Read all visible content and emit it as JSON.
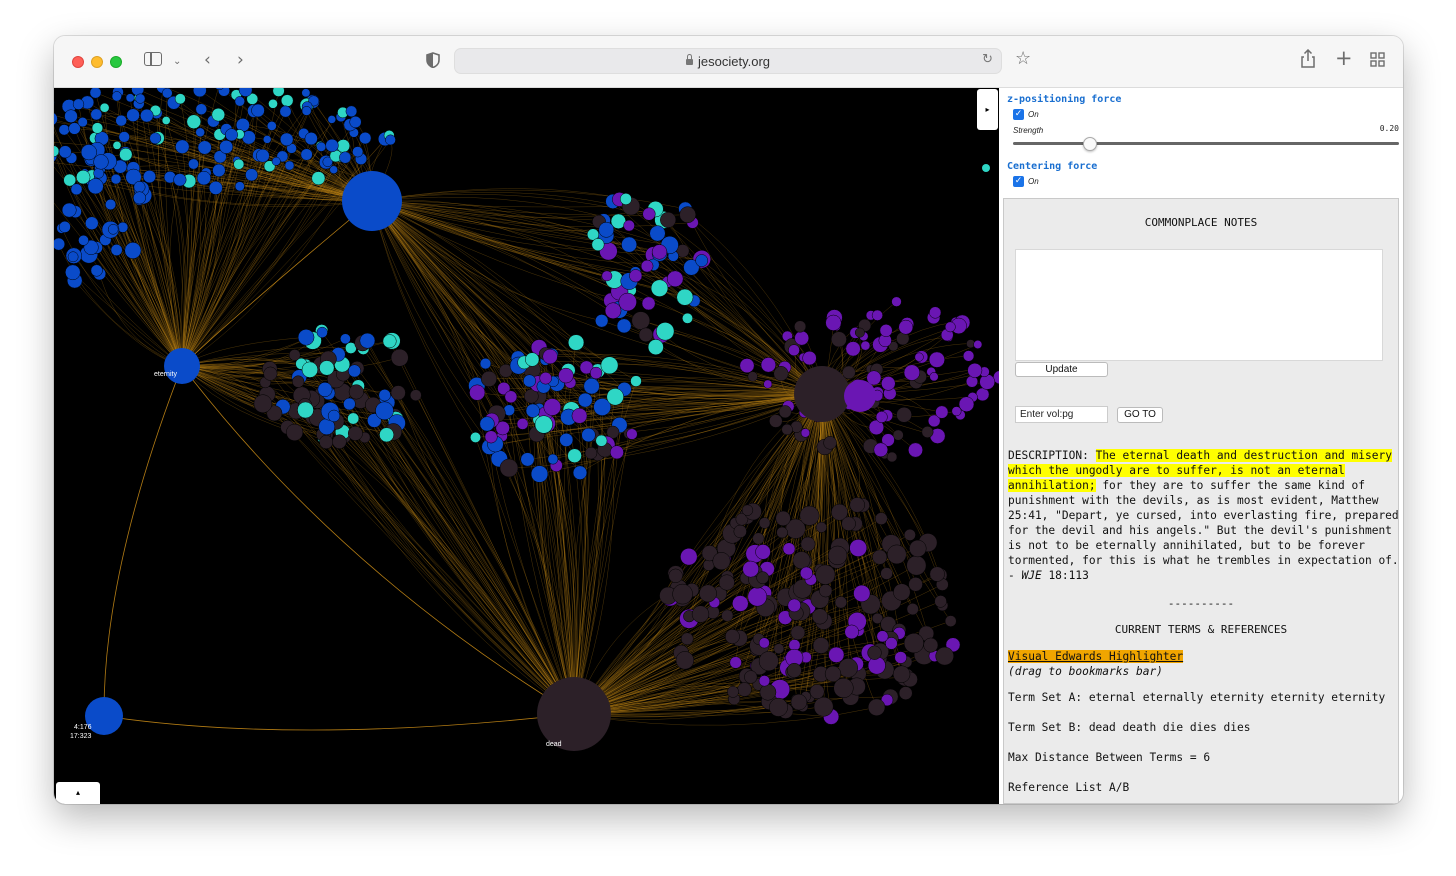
{
  "browser": {
    "url": "jesociety.org",
    "icons": {
      "sidebar": "sidebar-icon",
      "dropdown": "chevron-down-icon",
      "back": "chevron-left-icon",
      "forward": "chevron-right-icon",
      "shield": "shield-icon",
      "reload": "reload-icon",
      "bookmark": "star-icon",
      "share": "share-icon",
      "new_tab": "plus-icon",
      "tab_overview": "grid-icon"
    }
  },
  "graph": {
    "collapse_label": "▸",
    "expand_label": "▴",
    "colors": {
      "background": "#000000",
      "edges": "#c68a16",
      "blue": "#0a4bc9",
      "cyan": "#2fd6c5",
      "purple": "#6a16b3",
      "dark": "#2c2028"
    },
    "hub_labels": {
      "eternity": "eternity",
      "dead": "dead",
      "corner_a": "4:176",
      "corner_b": "17:323"
    }
  },
  "controls": {
    "z_force": {
      "title": "z-positioning force",
      "checked": true,
      "label": "On",
      "strength_label": "Strength",
      "strength_value": "0.20",
      "strength_fraction": 0.2
    },
    "centering": {
      "title": "Centering force",
      "checked": true,
      "label": "On"
    }
  },
  "notes": {
    "title": "COMMONPLACE NOTES",
    "textarea_value": "",
    "update_label": "Update",
    "goto_placeholder": "Enter vol:pg",
    "goto_label": "GO TO",
    "description_label": "DESCRIPTION:",
    "description_highlight": "The eternal death and destruction and misery which the ungodly are to suffer, is not an eternal annihilation;",
    "description_rest": "for they are to suffer the same kind of punishment with the devils, as is most evident, Matthew 25:41, \"Depart, ye cursed, into everlasting fire, prepared for the devil and his angels.\" But the devil's punishment is not to be eternally annihilated, but to be forever tormented, for this is what he trembles in expectation of. - ",
    "description_source": "WJE",
    "description_cite": " 18:113",
    "separator": "----------",
    "terms_title": "CURRENT TERMS & REFERENCES",
    "highlighter_link": "Visual Edwards Highlighter ",
    "highlighter_hint": "(drag to bookmarks bar)",
    "term_set_a": "Term Set A: eternal eternally eternity eternity eternity",
    "term_set_b": "Term Set B: dead death die dies dies",
    "max_distance": "Max Distance Between Terms = 6",
    "reference_list": "Reference List A/B"
  }
}
